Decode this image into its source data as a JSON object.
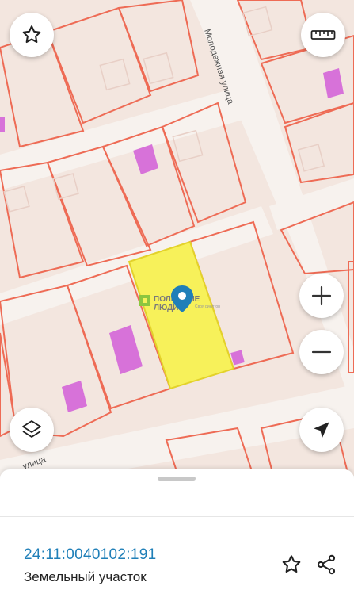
{
  "map": {
    "street_labels": [
      "Молодежная улица",
      "улица"
    ],
    "watermark": {
      "line1": "ПОЛЕЗНЫЕ",
      "line2": "ЛЮДИ",
      "tagline": "Своя\nриелтор"
    },
    "colors": {
      "background": "#f3e6df",
      "road": "#f7f2ee",
      "parcel_border": "#ee6b55",
      "building": "#d772d9",
      "selected_parcel": "#f7f15a",
      "selected_border": "#e3d22a",
      "marker": "#1f7fb8"
    },
    "icons": [
      "star-icon",
      "ruler-icon",
      "zoom-in-icon",
      "zoom-out-icon",
      "layers-icon",
      "location-arrow-icon",
      "map-marker-icon"
    ]
  },
  "parcel": {
    "cadastral_number": "24:11:0040102:191",
    "type": "Земельный участок"
  }
}
